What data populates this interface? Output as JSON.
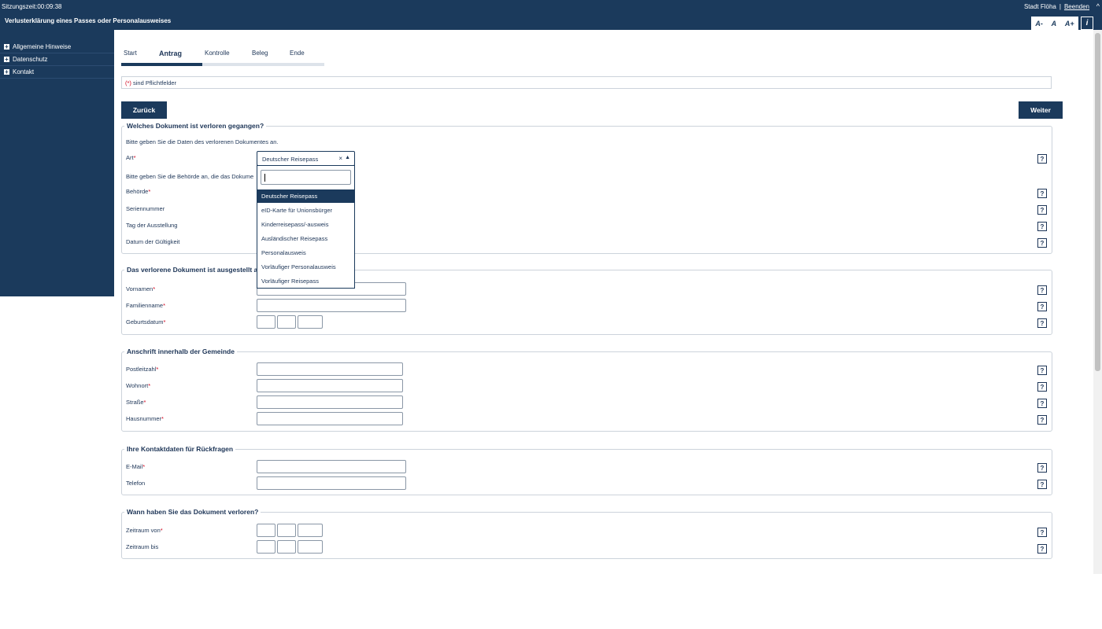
{
  "header": {
    "session": "Sitzungszeit:00:09:38",
    "title": "Verlusterklärung eines Passes oder Personalausweises",
    "city": "Stadt Flöha",
    "separator": "|",
    "end_link": "Beenden",
    "font_controls": [
      "A-",
      "A",
      "A+"
    ],
    "info_label": "i"
  },
  "sidebar": {
    "items": [
      {
        "label": "Allgemeine Hinweise"
      },
      {
        "label": "Datenschutz"
      },
      {
        "label": "Kontakt"
      }
    ],
    "expand_glyph": "+"
  },
  "steps": {
    "items": [
      "Start",
      "Antrag",
      "Kontrolle",
      "Beleg",
      "Ende"
    ],
    "active_index": 1
  },
  "notice": {
    "required_marker": "(*)",
    "text": " sind Pflichtfelder"
  },
  "buttons": {
    "back": "Zurück",
    "next": "Weiter"
  },
  "required_star": "*",
  "help_glyph": "?",
  "sections": {
    "document": {
      "legend": "Welches Dokument ist verloren gegangen?",
      "intro": "Bitte geben Sie die Daten des verlorenen Dokumentes an.",
      "art_label": "Art",
      "authority_intro": "Bitte geben Sie die Behörde an, die das Dokume",
      "behoerde_label": "Behörde",
      "serial_label": "Seriennummer",
      "issue_label": "Tag der Ausstellung",
      "validity_label": "Datum der Gültigkeit"
    },
    "person": {
      "legend": "Das verlorene Dokument ist ausgestellt a",
      "firstname_label": "Vornamen",
      "lastname_label": "Familienname",
      "birthdate_label": "Geburtsdatum"
    },
    "address": {
      "legend": "Anschrift innerhalb der Gemeinde",
      "zip_label": "Postleitzahl",
      "city_label": "Wohnort",
      "street_label": "Straße",
      "housenumber_label": "Hausnummer"
    },
    "contact": {
      "legend": "Ihre Kontaktdaten für Rückfragen",
      "email_label": "E-Mail",
      "phone_label": "Telefon"
    },
    "when": {
      "legend": "Wann haben Sie das Dokument verloren?",
      "from_label": "Zeitraum von",
      "to_label": "Zeitraum bis"
    }
  },
  "art_select": {
    "selected": "Deutscher Reisepass",
    "clear_glyph": "×",
    "arrow_glyph": "▲",
    "options": [
      "Deutscher Reisepass",
      "eID-Karte für Unionsbürger",
      "Kinderreisepass/-ausweis",
      "Ausländischer Reisepass",
      "Personalausweis",
      "Vorläufiger Personalausweis",
      "Vorläufiger Reisepass"
    ],
    "highlighted_index": 0
  },
  "colors": {
    "brand": "#1b3a5c",
    "required": "#d0021b",
    "border": "#ccd3db"
  }
}
